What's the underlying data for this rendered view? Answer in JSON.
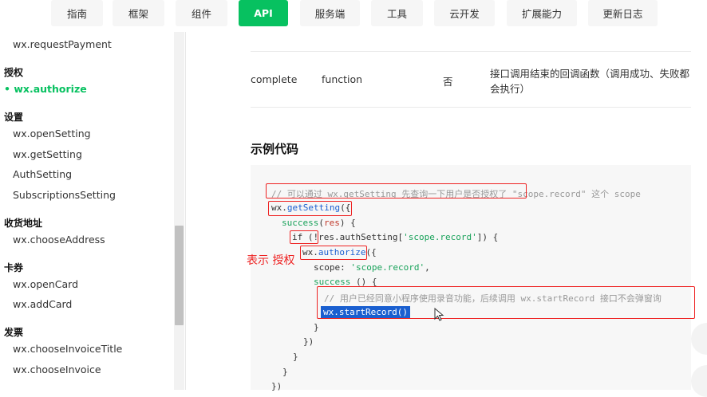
{
  "nav": {
    "tabs": [
      "指南",
      "框架",
      "组件",
      "API",
      "服务端",
      "工具",
      "云开发",
      "扩展能力",
      "更新日志"
    ],
    "active": "API",
    "accent": "#07c160"
  },
  "sidebar": {
    "prev_item": "wx.requestPayment",
    "auth_head": "授权",
    "auth_active": "• wx.authorize",
    "settings_head": "设置",
    "settings_items": [
      "wx.openSetting",
      "wx.getSetting",
      "AuthSetting",
      "SubscriptionsSetting"
    ],
    "address_head": "收货地址",
    "address_items": [
      "wx.chooseAddress"
    ],
    "card_head": "卡券",
    "card_items": [
      "wx.openCard",
      "wx.addCard"
    ],
    "invoice_head": "发票",
    "invoice_items": [
      "wx.chooseInvoiceTitle",
      "wx.chooseInvoice"
    ]
  },
  "param_row": {
    "name": "complete",
    "type": "function",
    "required": "否",
    "desc_line1": "接口调用结束的回调函数（调用成功、失败都",
    "desc_line2": "会执行）"
  },
  "section_title": "示例代码",
  "code": {
    "l1": "// 可以通过 wx.getSetting 先查询一下用户是否授权了 \"scope.record\" 这个 scope",
    "l2_a": "wx.",
    "l2_b": "getSetting",
    "l2_c": "({",
    "l3_a": "success",
    "l3_b": "(",
    "l3_c": "res",
    "l3_d": ") {",
    "l4_a": "if (!res.authSetting[",
    "l4_b": "'scope.record'",
    "l4_c": "]) {",
    "l5_a": "wx.",
    "l5_b": "authorize",
    "l5_c": "({",
    "l6_a": "scope: ",
    "l6_b": "'scope.record'",
    "l6_c": ",",
    "l7_a": "success",
    "l7_b": " () {",
    "l8": "// 用户已经同意小程序使用录音功能，后续调用 wx.startRecord 接口不会弹窗询",
    "l9": "wx.startRecord()",
    "l10": "}",
    "l11": "})",
    "l12": "}",
    "l13": "}",
    "l14": "})"
  },
  "annotation": {
    "label": "表示 授权",
    "color": "#e22222"
  }
}
